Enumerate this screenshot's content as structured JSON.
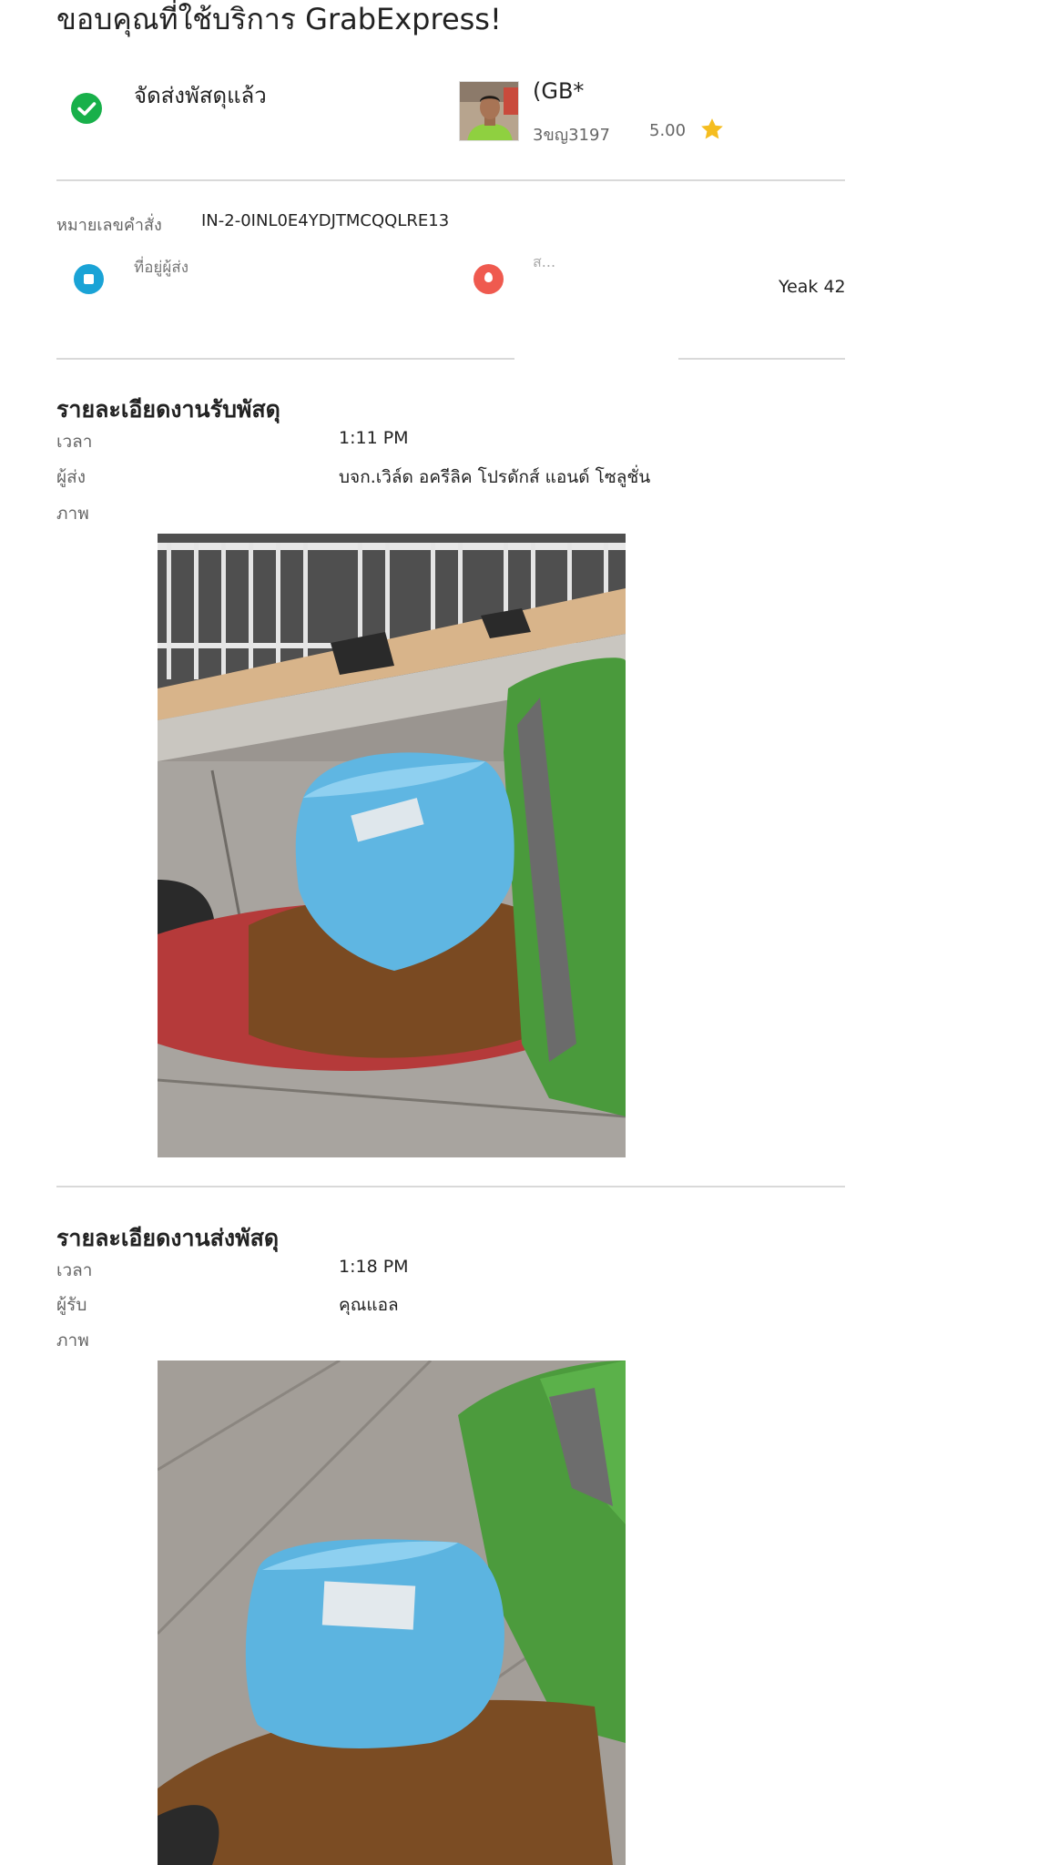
{
  "header": {
    "title": "ขอบคุณที่ใช้บริการ GrabExpress!"
  },
  "status": {
    "label": "จัดส่งพัสดุแล้ว",
    "icon": "check-circle-icon",
    "color": "#18b04a"
  },
  "driver": {
    "name": "(GB*",
    "plate": "3ขญ3197",
    "rating": "5.00",
    "rating_icon": "star-icon",
    "star_color": "#f5bd1f"
  },
  "order": {
    "label": "หมายเลขคำสั่ง",
    "number": "IN-2-0INL0E4YDJTMCQQLRE13"
  },
  "route": {
    "pickup_label": "ที่อยู่ผู้ส่ง",
    "pickup_icon": "pickup-pin-icon",
    "dropoff_label": "ส...",
    "dropoff_icon": "dropoff-pin-icon",
    "dropoff_address_tail": "Yeak 42"
  },
  "pickup_details": {
    "title": "รายละเอียดงานรับพัสดุ",
    "time_label": "เวลา",
    "time": "1:11 PM",
    "person_label": "ผู้ส่ง",
    "person": "บจก.เวิล์ด อครีลิค โปรดักส์ แอนด์ โซลูชั่น",
    "photo_label": "ภาพ"
  },
  "delivery_details": {
    "title": "รายละเอียดงานส่งพัสดุ",
    "time_label": "เวลา",
    "time": "1:18 PM",
    "person_label": "ผู้รับ",
    "person": "คุณแอล",
    "photo_label": "ภาพ"
  }
}
